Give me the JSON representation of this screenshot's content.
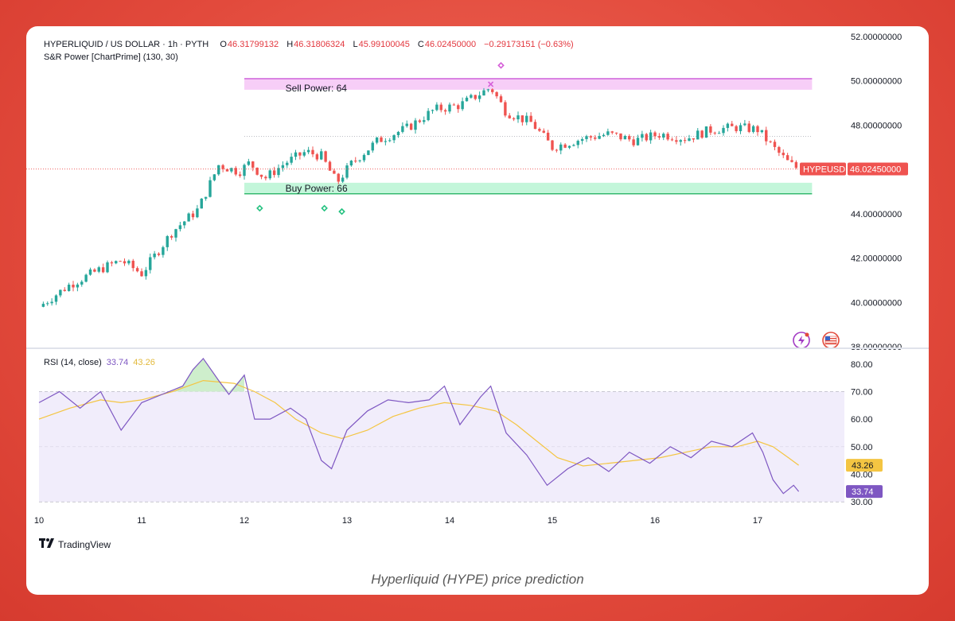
{
  "header": {
    "symbol": "HYPERLIQUID / US DOLLAR · 1h · PYTH",
    "open_label": "O",
    "open": "46.31799132",
    "high_label": "H",
    "high": "46.31806324",
    "low_label": "L",
    "low": "45.99100045",
    "close_label": "C",
    "close": "46.02450000",
    "change": "−0.29173151 (−0.63%)"
  },
  "indicator": {
    "label": "S&R Power [ChartPrime] (130, 30)",
    "sell_label": "Sell Power: 64",
    "buy_label": "Buy Power: 66"
  },
  "price_tag": {
    "symbol": "HYPEUSD",
    "value": "46.02450000"
  },
  "rsi": {
    "label": "RSI (14, close)",
    "value": "33.74",
    "ma_value": "43.26"
  },
  "branding": {
    "name": "TradingView"
  },
  "caption": "Hyperliquid (HYPE) price prediction",
  "colors": {
    "up": "#26a69a",
    "down": "#ef5350",
    "rsi": "#7e57c2",
    "rsi_ma": "#f4c542",
    "sell_zone": "#f6c6f6",
    "buy_zone": "#b9f5d3",
    "accent": "#e24a3c"
  },
  "chart_data": [
    {
      "type": "candlestick",
      "x_ticks": [
        "10",
        "11",
        "12",
        "13",
        "14",
        "15",
        "16",
        "17"
      ],
      "y_ticks": [
        "38.00000000",
        "40.00000000",
        "42.00000000",
        "44.00000000",
        "46.00000000",
        "48.00000000",
        "50.00000000",
        "52.00000000"
      ],
      "ylim": [
        38,
        52
      ],
      "last_price": 46.0245,
      "sell_zone": [
        49.6,
        50.1
      ],
      "buy_zone": [
        44.9,
        45.4
      ],
      "close_path": [
        [
          10.0,
          39.8
        ],
        [
          10.3,
          40.8
        ],
        [
          10.6,
          41.5
        ],
        [
          10.8,
          41.9
        ],
        [
          11.0,
          41.3
        ],
        [
          11.3,
          43.2
        ],
        [
          11.55,
          44.2
        ],
        [
          11.75,
          46.2
        ],
        [
          11.95,
          45.9
        ],
        [
          12.05,
          46.3
        ],
        [
          12.2,
          45.6
        ],
        [
          12.4,
          46.3
        ],
        [
          12.6,
          46.8
        ],
        [
          12.75,
          46.6
        ],
        [
          12.9,
          45.4
        ],
        [
          13.05,
          46.3
        ],
        [
          13.3,
          47.3
        ],
        [
          13.6,
          47.9
        ],
        [
          13.85,
          48.7
        ],
        [
          14.1,
          48.9
        ],
        [
          14.4,
          49.7
        ],
        [
          14.55,
          48.6
        ],
        [
          14.8,
          48.1
        ],
        [
          15.0,
          47.0
        ],
        [
          15.3,
          47.4
        ],
        [
          15.55,
          47.6
        ],
        [
          15.8,
          47.3
        ],
        [
          16.05,
          47.6
        ],
        [
          16.3,
          47.4
        ],
        [
          16.55,
          47.8
        ],
        [
          16.8,
          47.9
        ],
        [
          17.0,
          47.8
        ],
        [
          17.15,
          47.0
        ],
        [
          17.3,
          46.3
        ],
        [
          17.4,
          46.02
        ]
      ]
    },
    {
      "type": "line",
      "x_ticks": [
        "10",
        "11",
        "12",
        "13",
        "14",
        "15",
        "16",
        "17"
      ],
      "y_ticks": [
        "30.00",
        "40.00",
        "50.00",
        "60.00",
        "70.00",
        "80.00"
      ],
      "ylim": [
        28,
        84
      ],
      "bands": [
        30,
        50,
        70
      ],
      "series": [
        {
          "values": [
            [
              10.0,
              66
            ],
            [
              10.2,
              70
            ],
            [
              10.4,
              64
            ],
            [
              10.6,
              70
            ],
            [
              10.8,
              56
            ],
            [
              11.0,
              66
            ],
            [
              11.2,
              69
            ],
            [
              11.4,
              72
            ],
            [
              11.5,
              78
            ],
            [
              11.6,
              82
            ],
            [
              11.75,
              74
            ],
            [
              11.85,
              69
            ],
            [
              12.0,
              76
            ],
            [
              12.1,
              60
            ],
            [
              12.25,
              60
            ],
            [
              12.45,
              64
            ],
            [
              12.6,
              60
            ],
            [
              12.75,
              45
            ],
            [
              12.85,
              42
            ],
            [
              13.0,
              56
            ],
            [
              13.2,
              63
            ],
            [
              13.4,
              67
            ],
            [
              13.6,
              66
            ],
            [
              13.8,
              67
            ],
            [
              13.95,
              72
            ],
            [
              14.1,
              58
            ],
            [
              14.3,
              68
            ],
            [
              14.4,
              72
            ],
            [
              14.55,
              55
            ],
            [
              14.75,
              47
            ],
            [
              14.95,
              36
            ],
            [
              15.15,
              42
            ],
            [
              15.35,
              46
            ],
            [
              15.55,
              41
            ],
            [
              15.75,
              48
            ],
            [
              15.95,
              44
            ],
            [
              16.15,
              50
            ],
            [
              16.35,
              46
            ],
            [
              16.55,
              52
            ],
            [
              16.75,
              50
            ],
            [
              16.95,
              55
            ],
            [
              17.05,
              48
            ],
            [
              17.15,
              38
            ],
            [
              17.25,
              33
            ],
            [
              17.35,
              36
            ],
            [
              17.4,
              33.74
            ]
          ]
        },
        {
          "values": [
            [
              10.0,
              60
            ],
            [
              10.3,
              64
            ],
            [
              10.6,
              67
            ],
            [
              10.8,
              66
            ],
            [
              11.0,
              67
            ],
            [
              11.3,
              70
            ],
            [
              11.6,
              74
            ],
            [
              11.9,
              73
            ],
            [
              12.1,
              70
            ],
            [
              12.3,
              66
            ],
            [
              12.5,
              60
            ],
            [
              12.75,
              55
            ],
            [
              12.95,
              53
            ],
            [
              13.2,
              56
            ],
            [
              13.45,
              61
            ],
            [
              13.7,
              64
            ],
            [
              13.95,
              66
            ],
            [
              14.2,
              65
            ],
            [
              14.45,
              63
            ],
            [
              14.65,
              58
            ],
            [
              14.85,
              52
            ],
            [
              15.05,
              46
            ],
            [
              15.3,
              43
            ],
            [
              15.55,
              44
            ],
            [
              15.8,
              45
            ],
            [
              16.05,
              46
            ],
            [
              16.3,
              48
            ],
            [
              16.55,
              50
            ],
            [
              16.8,
              50
            ],
            [
              17.0,
              52
            ],
            [
              17.15,
              50
            ],
            [
              17.3,
              46
            ],
            [
              17.4,
              43.26
            ]
          ]
        }
      ]
    }
  ]
}
